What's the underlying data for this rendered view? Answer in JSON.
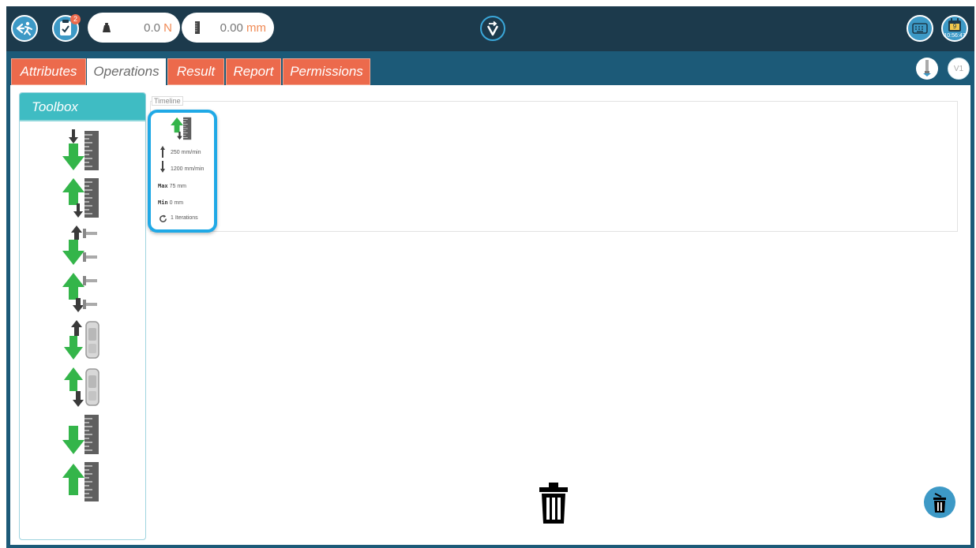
{
  "header": {
    "notification_count": "2",
    "force": {
      "value": "0.0",
      "unit": "N"
    },
    "position": {
      "value": "0.00",
      "unit": "mm"
    },
    "calendar_day": "9",
    "clock": "10:56:47",
    "icons": [
      "exit-icon",
      "tests-icon",
      "weight-icon",
      "ruler-icon",
      "logo-icon",
      "keyboard-icon",
      "calendar-icon"
    ]
  },
  "tabs": [
    {
      "label": "Attributes",
      "active": false
    },
    {
      "label": "Operations",
      "active": true
    },
    {
      "label": "Result",
      "active": false
    },
    {
      "label": "Report",
      "active": false
    },
    {
      "label": "Permissions",
      "active": false
    }
  ],
  "side": {
    "version_label": "V1",
    "icon": "probe-icon"
  },
  "toolbox": {
    "title": "Toolbox",
    "items": [
      "move-down-ruler-icon",
      "move-up-ruler-icon",
      "move-down-probe-icon",
      "move-up-probe-icon",
      "move-down-gauge-icon",
      "move-up-gauge-icon",
      "down-ruler-icon",
      "up-ruler-icon"
    ]
  },
  "timeline": {
    "label": "Timeline",
    "operation": {
      "speed_up": "250 mm/min",
      "speed_down": "1200 mm/min",
      "max_label": "Max",
      "max_value": "75 mm",
      "min_label": "Min",
      "min_value": "0 mm",
      "iterations": "1 Iterations"
    }
  },
  "colors": {
    "topbar": "#1c3a4c",
    "tabstrip": "#1c5a78",
    "tab": "#ec6a4c",
    "accent": "#3d99c6",
    "toolbox_header": "#3fbcc3",
    "selected_outline": "#20a9e6",
    "arrow_green": "#34b54a",
    "arrow_dark": "#3a3a3a",
    "unit_orange": "#f08a55"
  }
}
